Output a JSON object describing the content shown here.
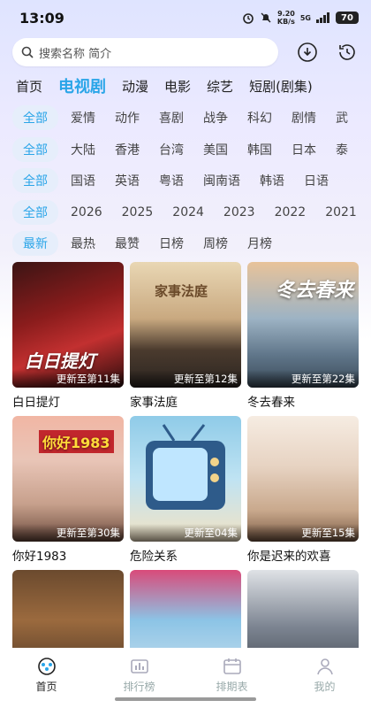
{
  "status": {
    "time": "13:09",
    "net_speed": "9.20",
    "net_unit": "KB/s",
    "signal": "5G",
    "battery": "70"
  },
  "search": {
    "placeholder": "搜索名称 简介"
  },
  "main_tabs": [
    "首页",
    "电视剧",
    "动漫",
    "电影",
    "综艺",
    "短剧(剧集)"
  ],
  "filters": {
    "genre": [
      "全部",
      "爱情",
      "动作",
      "喜剧",
      "战争",
      "科幻",
      "剧情",
      "武"
    ],
    "region": [
      "全部",
      "大陆",
      "香港",
      "台湾",
      "美国",
      "韩国",
      "日本",
      "泰"
    ],
    "language": [
      "全部",
      "国语",
      "英语",
      "粤语",
      "闽南语",
      "韩语",
      "日语"
    ],
    "year": [
      "全部",
      "2026",
      "2025",
      "2024",
      "2023",
      "2022",
      "2021"
    ],
    "sort": [
      "最新",
      "最热",
      "最赞",
      "日榜",
      "周榜",
      "月榜"
    ]
  },
  "shows": [
    {
      "title": "白日提灯",
      "badge": "更新至第11集",
      "overlay": "白日提灯"
    },
    {
      "title": "家事法庭",
      "badge": "更新至第12集",
      "overlay": "家事法庭"
    },
    {
      "title": "冬去春来",
      "badge": "更新至第22集",
      "overlay": "冬去春来"
    },
    {
      "title": "你好1983",
      "badge": "更新至第30集",
      "overlay": "你好1983"
    },
    {
      "title": "危险关系",
      "badge": "更新至04集",
      "overlay": ""
    },
    {
      "title": "你是迟来的欢喜",
      "badge": "更新至15集",
      "overlay": ""
    },
    {
      "title": "",
      "badge": "",
      "overlay": ""
    },
    {
      "title": "",
      "badge": "",
      "overlay": ""
    },
    {
      "title": "",
      "badge": "",
      "overlay": ""
    }
  ],
  "bottom_nav": [
    {
      "label": "首页",
      "icon": "home-icon"
    },
    {
      "label": "排行榜",
      "icon": "ranking-icon"
    },
    {
      "label": "排期表",
      "icon": "schedule-icon"
    },
    {
      "label": "我的",
      "icon": "profile-icon"
    }
  ],
  "colors": {
    "accent": "#2aa5e8",
    "chip_bg": "#e6eefb"
  }
}
